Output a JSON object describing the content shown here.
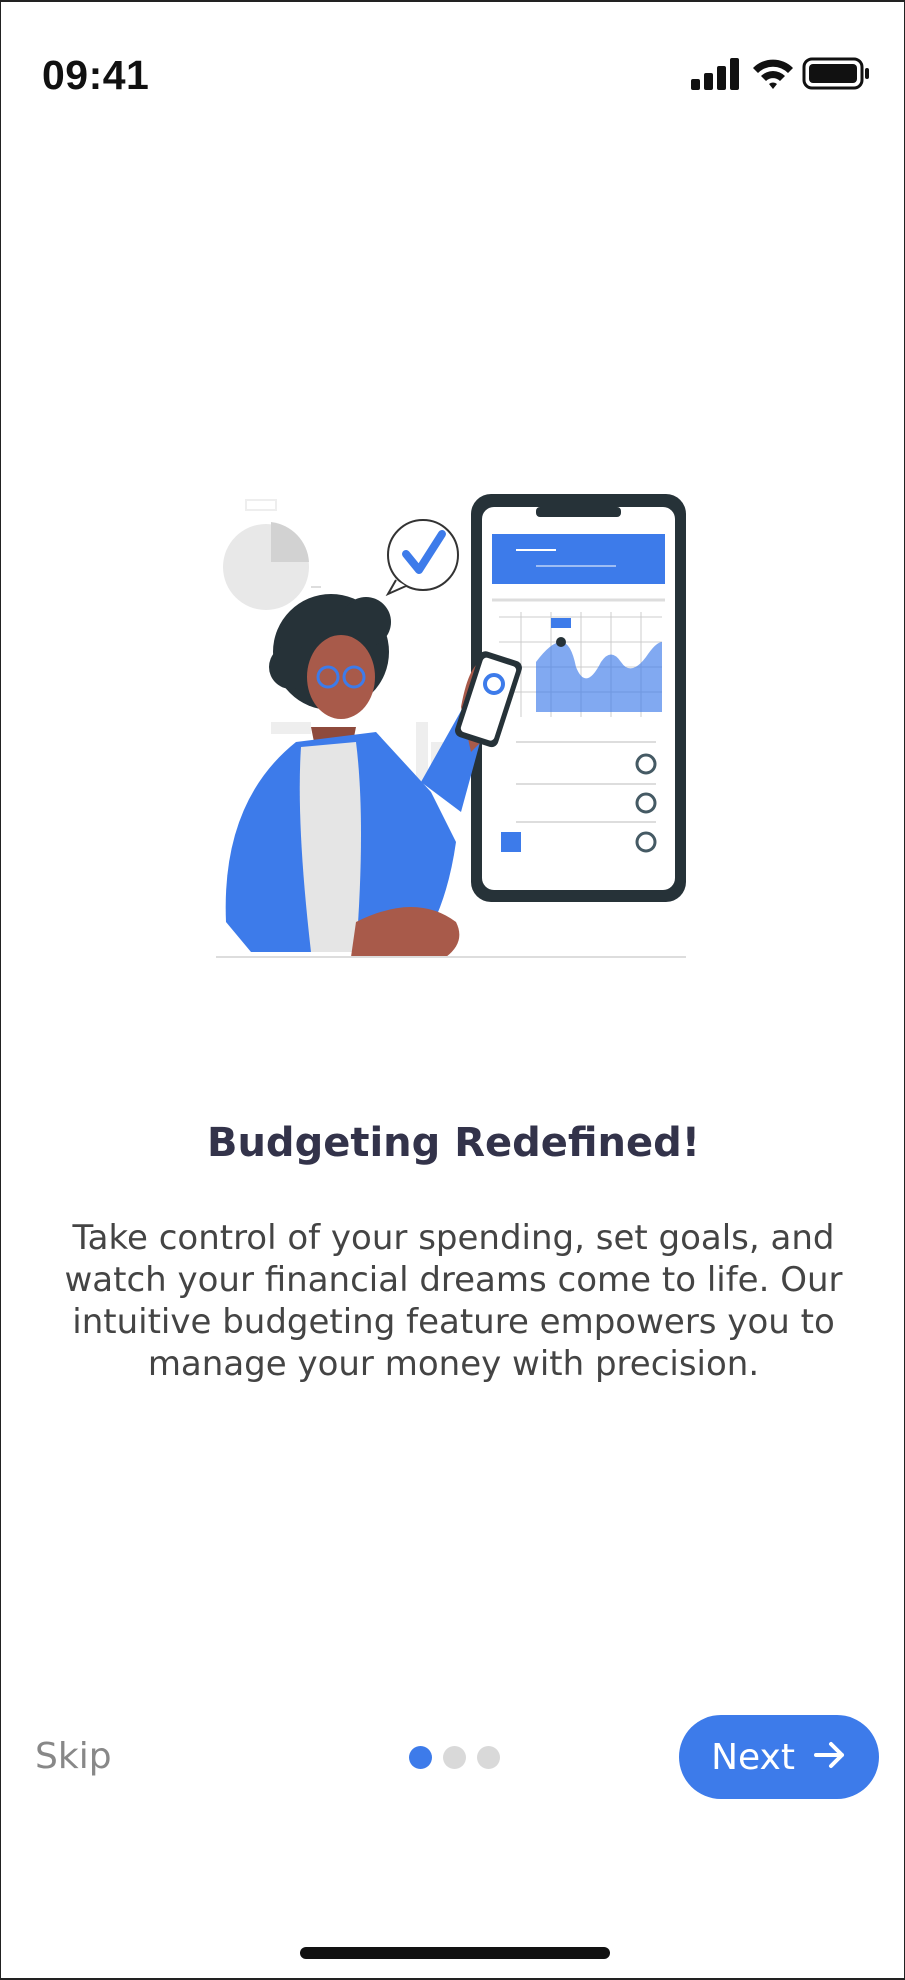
{
  "status_bar": {
    "time": "09:41",
    "icons": [
      "signal-icon",
      "wifi-icon",
      "battery-icon"
    ]
  },
  "onboarding": {
    "illustration": "woman-with-phone-budget-illustration",
    "title": "Budgeting Redefined!",
    "description_lines": [
      "Take control of your spending, set goals, and",
      "watch your financial dreams come to life. Our",
      "intuitive budgeting feature empowers you to",
      "manage your money with precision."
    ]
  },
  "footer": {
    "skip_label": "Skip",
    "next_label": "Next",
    "next_icon": "arrow-right-icon",
    "pages_total": 3,
    "current_page": 1
  },
  "colors": {
    "accent": "#3d7bea",
    "title": "#33334a",
    "body_text": "#444444",
    "muted": "#888888",
    "dot_inactive": "#d9d9d9"
  }
}
